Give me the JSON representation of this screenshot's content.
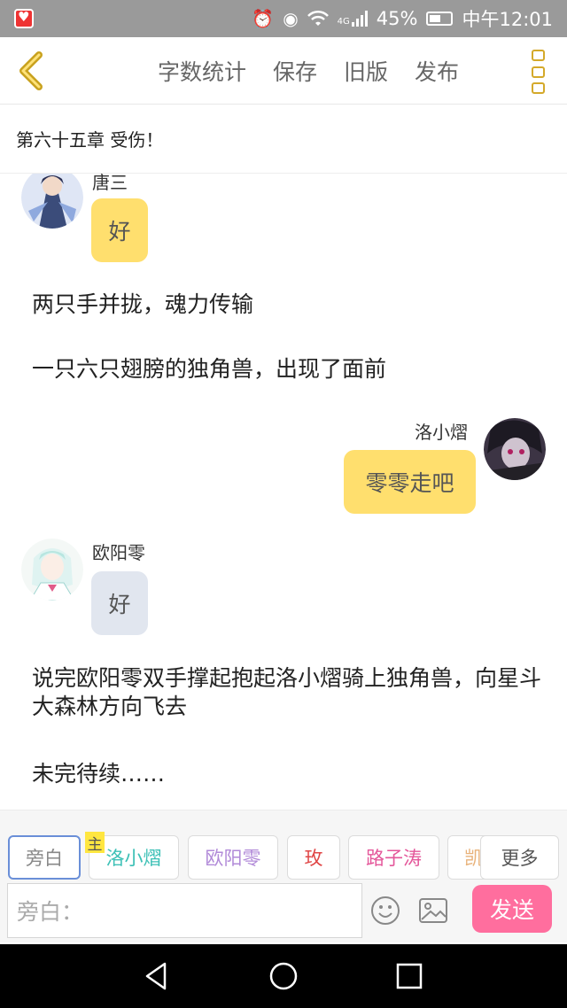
{
  "status_bar": {
    "network": "4G",
    "battery": "45%",
    "time": "中午12:01"
  },
  "toolbar": {
    "word_count": "字数统计",
    "save": "保存",
    "old_version": "旧版",
    "publish": "发布"
  },
  "chapter": {
    "title": "第六十五章 受伤！"
  },
  "messages": [
    {
      "speaker": "唐三",
      "text": "好",
      "side": "left",
      "color": "#ffdf6e"
    },
    {
      "narration": "两只手并拢，魂力传输"
    },
    {
      "narration": "一只六只翅膀的独角兽，出现了面前"
    },
    {
      "speaker": "洛小熠",
      "text": "零零走吧",
      "side": "right",
      "color": "#ffdf6e"
    },
    {
      "speaker": "欧阳零",
      "text": "好",
      "side": "left",
      "color": "#e1e6ef"
    },
    {
      "narration": "说完欧阳零双手撑起抱起洛小熠骑上独角兽，向星斗大森林方向飞去"
    },
    {
      "narration": "未完待续……"
    }
  ],
  "characters": [
    {
      "name": "旁白",
      "color": "#888888"
    },
    {
      "name": "洛小熠",
      "color": "#3cc0b6",
      "badge": "主"
    },
    {
      "name": "欧阳零",
      "color": "#b18ad8"
    },
    {
      "name": "玫",
      "color": "#e04646"
    },
    {
      "name": "路子涛",
      "color": "#e4569a"
    },
    {
      "name": "凯",
      "color": "#e8b27a"
    }
  ],
  "more_characters": "更多",
  "input": {
    "placeholder": "旁白："
  },
  "send": "发送"
}
